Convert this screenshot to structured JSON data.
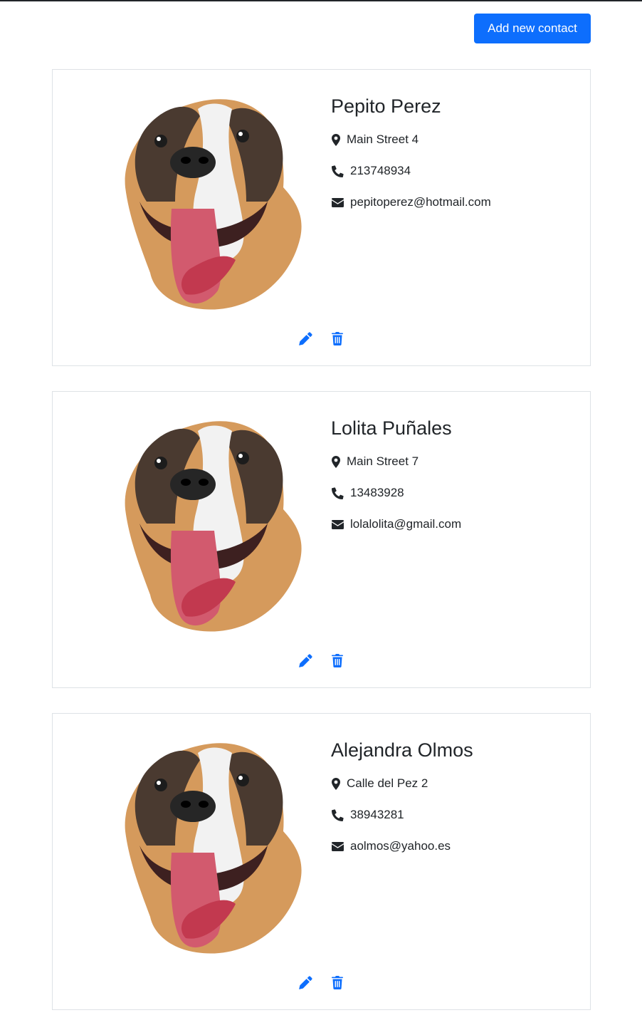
{
  "header": {
    "add_button_label": "Add new contact"
  },
  "colors": {
    "accent": "#0d6efd",
    "text": "#212529",
    "border": "#dee2e6"
  },
  "contacts": [
    {
      "name": "Pepito Perez",
      "address": "Main Street 4",
      "phone": "213748934",
      "email": "pepitoperez@hotmail.com"
    },
    {
      "name": "Lolita Puñales",
      "address": "Main Street 7",
      "phone": "13483928",
      "email": "lolalolita@gmail.com"
    },
    {
      "name": "Alejandra Olmos",
      "address": "Calle del Pez 2",
      "phone": "38943281",
      "email": "aolmos@yahoo.es"
    }
  ],
  "icons": {
    "address": "map-marker-icon",
    "phone": "phone-icon",
    "email": "envelope-icon",
    "edit": "pencil-icon",
    "delete": "trash-icon"
  }
}
